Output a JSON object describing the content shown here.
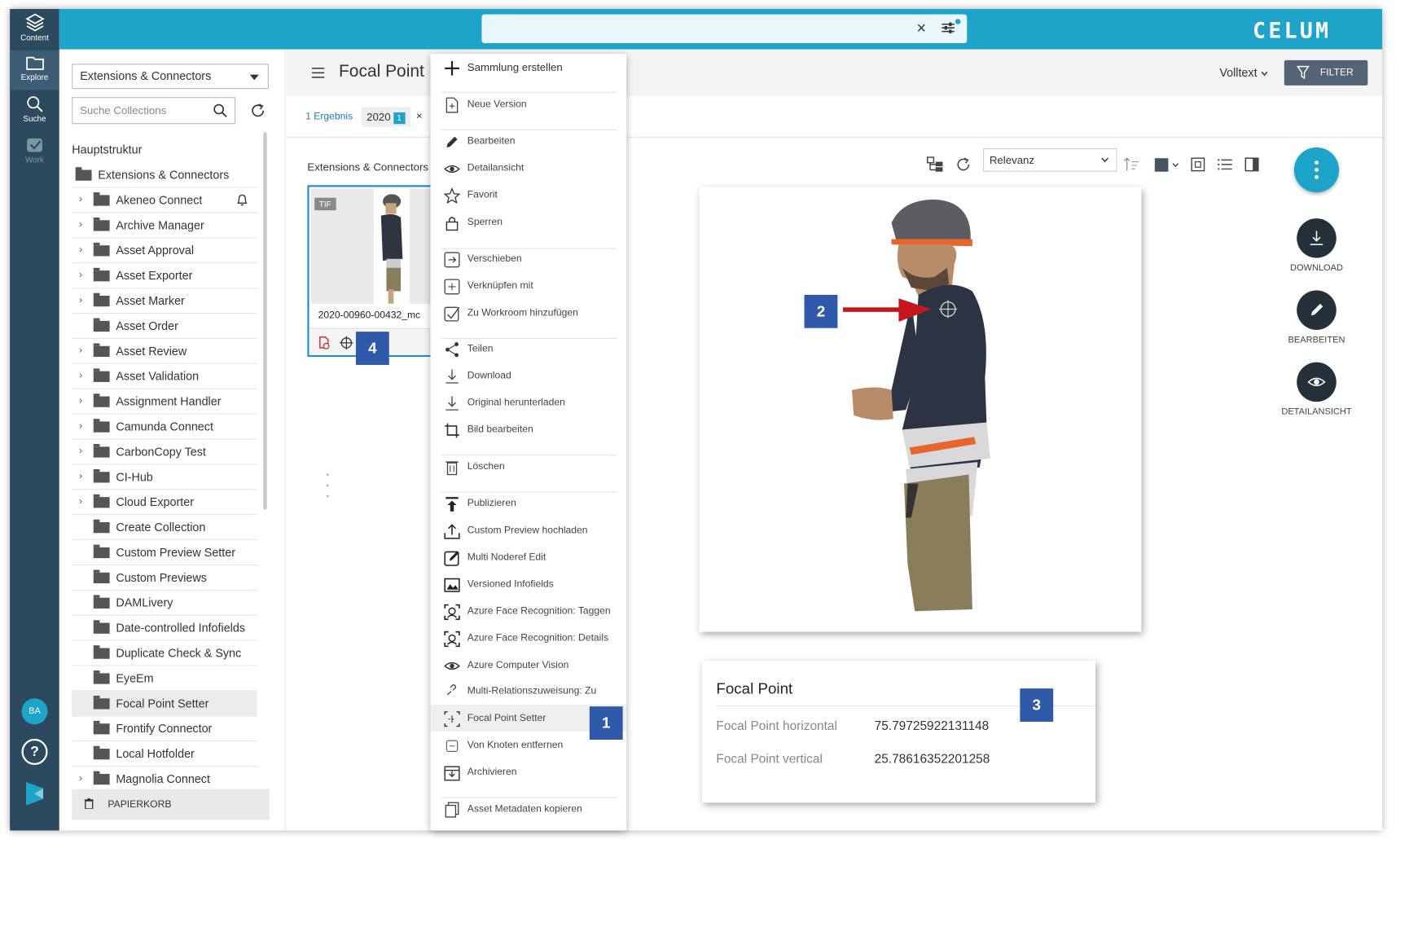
{
  "rail": {
    "items": [
      {
        "label": "Content"
      },
      {
        "label": "Explore"
      },
      {
        "label": "Suche"
      },
      {
        "label": "Work"
      }
    ],
    "avatar": "BA",
    "help": "?"
  },
  "topbar": {
    "clear_symbol": "×",
    "brand": "CELUM"
  },
  "left_panel": {
    "select_value": "Extensions & Connectors",
    "search_placeholder": "Suche Collections",
    "section_title": "Hauptstruktur",
    "root": "Extensions & Connectors",
    "tree": [
      "Akeneo Connect",
      "Archive Manager",
      "Asset Approval",
      "Asset Exporter",
      "Asset Marker",
      "Asset Order",
      "Asset Review",
      "Asset Validation",
      "Assignment Handler",
      "Camunda Connect",
      "CarbonCopy Test",
      "CI-Hub",
      "Cloud Exporter",
      "Create Collection",
      "Custom Preview Setter",
      "Custom Previews",
      "DAMLivery",
      "Date-controlled Infofields",
      "Duplicate Check & Sync",
      "EyeEm",
      "Focal Point Setter",
      "Frontify Connector",
      "Local Hotfolder",
      "Magnolia Connect"
    ],
    "trash": "PAPIERKORB"
  },
  "header": {
    "title": "Focal Point",
    "volltext": "Volltext",
    "filter": "FILTER"
  },
  "chips": {
    "result": "1 Ergebnis",
    "chip_label": "2020",
    "chip_count": "1",
    "remove": "×"
  },
  "breadcrumb": "Extensions & Connectors",
  "sort": {
    "value": "Relevanz"
  },
  "card": {
    "badge": "TIF",
    "name": "2020-00960-00432_mc"
  },
  "menu": {
    "items": [
      "Sammlung erstellen",
      "Neue Version",
      "Bearbeiten",
      "Detailansicht",
      "Favorit",
      "Sperren",
      "Verschieben",
      "Verknüpfen mit",
      "Zu Workroom hinzufügen",
      "Teilen",
      "Download",
      "Original herunterladen",
      "Bild bearbeiten",
      "Löschen",
      "Publizieren",
      "Custom Preview hochladen",
      "Multi Noderef Edit",
      "Versioned Infofields",
      "Azure Face Recognition: Taggen",
      "Azure Face Recognition: Details",
      "Azure Computer Vision",
      "Multi-Relationszuweisung: Zu",
      "Focal Point Setter",
      "Von Knoten entfernen",
      "Archivieren",
      "Asset Metadaten kopieren"
    ]
  },
  "focal_info": {
    "title": "Focal Point",
    "h_label": "Focal Point horizontal",
    "h_value": "75.79725922131148",
    "v_label": "Focal Point vertical",
    "v_value": "25.78616352201258"
  },
  "actions": {
    "download": "DOWNLOAD",
    "edit": "BEARBEITEN",
    "detail": "DETAILANSICHT"
  },
  "badges": {
    "b1": "1",
    "b2": "2",
    "b3": "3",
    "b4": "4"
  },
  "colors": {
    "accent": "#1fa4c9",
    "rail": "#2c4a5e",
    "badge": "#2f59a9",
    "arrow": "#c4161c"
  }
}
